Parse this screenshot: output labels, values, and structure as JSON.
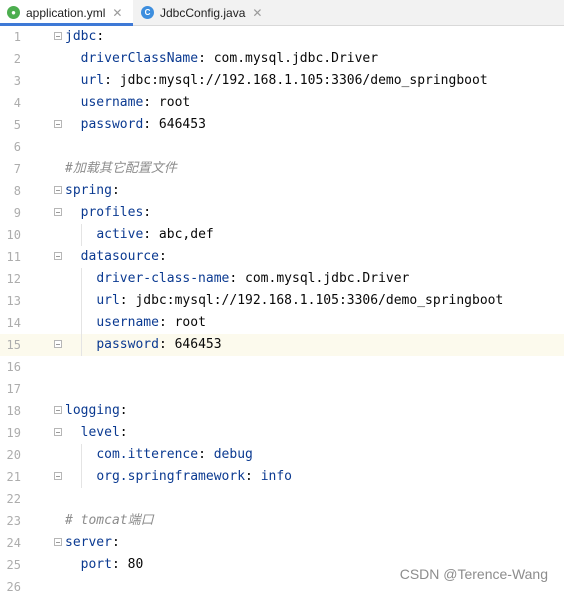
{
  "tabs": [
    {
      "label": "application.yml",
      "icon": "yaml-file-icon",
      "active": true
    },
    {
      "label": "JdbcConfig.java",
      "icon": "java-class-icon",
      "active": false
    }
  ],
  "editor": {
    "current_line": 15,
    "lines": [
      {
        "n": "1",
        "parts": [
          {
            "t": "jdbc",
            "c": "key"
          },
          {
            "t": ":",
            "c": "val"
          }
        ]
      },
      {
        "n": "2",
        "parts": [
          {
            "t": "  "
          },
          {
            "t": "driverClassName",
            "c": "key"
          },
          {
            "t": ": com.mysql.jdbc.Driver",
            "c": "val"
          }
        ]
      },
      {
        "n": "3",
        "parts": [
          {
            "t": "  "
          },
          {
            "t": "url",
            "c": "key"
          },
          {
            "t": ": jdbc:mysql://192.168.1.105:3306/demo_springboot",
            "c": "val"
          }
        ]
      },
      {
        "n": "4",
        "parts": [
          {
            "t": "  "
          },
          {
            "t": "username",
            "c": "key"
          },
          {
            "t": ": root",
            "c": "val"
          }
        ]
      },
      {
        "n": "5",
        "parts": [
          {
            "t": "  "
          },
          {
            "t": "password",
            "c": "key"
          },
          {
            "t": ": 646453",
            "c": "val"
          }
        ]
      },
      {
        "n": "6",
        "parts": []
      },
      {
        "n": "7",
        "parts": [
          {
            "t": "#加载其它配置文件",
            "c": "comment"
          }
        ]
      },
      {
        "n": "8",
        "parts": [
          {
            "t": "spring",
            "c": "key"
          },
          {
            "t": ":",
            "c": "val"
          }
        ]
      },
      {
        "n": "9",
        "parts": [
          {
            "t": "  "
          },
          {
            "t": "profiles",
            "c": "key"
          },
          {
            "t": ":",
            "c": "val"
          }
        ]
      },
      {
        "n": "10",
        "parts": [
          {
            "t": "    "
          },
          {
            "t": "active",
            "c": "key"
          },
          {
            "t": ": abc,def",
            "c": "val"
          }
        ]
      },
      {
        "n": "11",
        "parts": [
          {
            "t": "  "
          },
          {
            "t": "datasource",
            "c": "key"
          },
          {
            "t": ":",
            "c": "val"
          }
        ]
      },
      {
        "n": "12",
        "parts": [
          {
            "t": "    "
          },
          {
            "t": "driver-class-name",
            "c": "key"
          },
          {
            "t": ": com.mysql.jdbc.Driver",
            "c": "val"
          }
        ]
      },
      {
        "n": "13",
        "parts": [
          {
            "t": "    "
          },
          {
            "t": "url",
            "c": "key"
          },
          {
            "t": ": jdbc:mysql://192.168.1.105:3306/demo_springboot",
            "c": "val"
          }
        ]
      },
      {
        "n": "14",
        "parts": [
          {
            "t": "    "
          },
          {
            "t": "username",
            "c": "key"
          },
          {
            "t": ": root",
            "c": "val"
          }
        ]
      },
      {
        "n": "15",
        "parts": [
          {
            "t": "    "
          },
          {
            "t": "password",
            "c": "key"
          },
          {
            "t": ": 646453",
            "c": "val"
          }
        ]
      },
      {
        "n": "16",
        "parts": []
      },
      {
        "n": "17",
        "parts": []
      },
      {
        "n": "18",
        "parts": [
          {
            "t": "logging",
            "c": "key"
          },
          {
            "t": ":",
            "c": "val"
          }
        ]
      },
      {
        "n": "19",
        "parts": [
          {
            "t": "  "
          },
          {
            "t": "level",
            "c": "key"
          },
          {
            "t": ":",
            "c": "val"
          }
        ]
      },
      {
        "n": "20",
        "parts": [
          {
            "t": "    "
          },
          {
            "t": "com.itterence",
            "c": "key"
          },
          {
            "t": ": ",
            "c": "val"
          },
          {
            "t": "debug",
            "c": "key"
          }
        ]
      },
      {
        "n": "21",
        "parts": [
          {
            "t": "    "
          },
          {
            "t": "org.springframework",
            "c": "key"
          },
          {
            "t": ": ",
            "c": "val"
          },
          {
            "t": "info",
            "c": "key"
          }
        ]
      },
      {
        "n": "22",
        "parts": []
      },
      {
        "n": "23",
        "parts": [
          {
            "t": "# tomcat端口",
            "c": "comment"
          }
        ]
      },
      {
        "n": "24",
        "parts": [
          {
            "t": "server",
            "c": "key"
          },
          {
            "t": ":",
            "c": "val"
          }
        ]
      },
      {
        "n": "25",
        "parts": [
          {
            "t": "  "
          },
          {
            "t": "port",
            "c": "key"
          },
          {
            "t": ": 80",
            "c": "val"
          }
        ]
      },
      {
        "n": "26",
        "parts": []
      }
    ]
  },
  "watermark": "CSDN @Terence-Wang",
  "colors": {
    "key": "#0b3a91",
    "comment": "#8c8c8c",
    "tab_accent": "#3e79d6",
    "current_line": "#fcfaed"
  }
}
